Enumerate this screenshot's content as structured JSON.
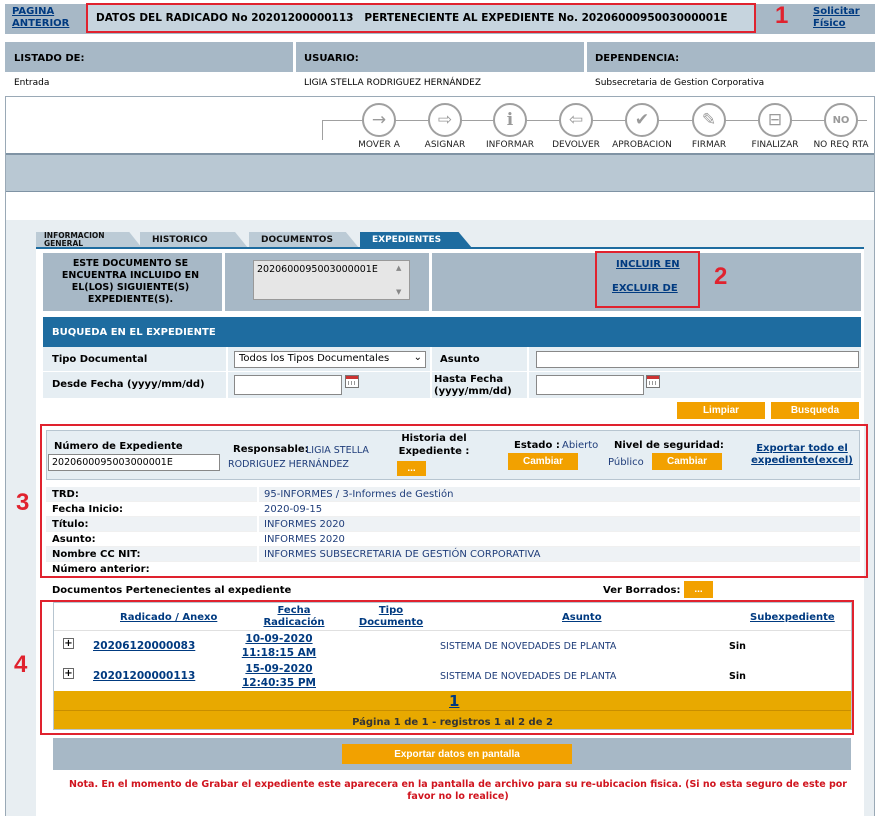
{
  "top": {
    "back_link": "PAGINA ANTERIOR",
    "radicado_title": "DATOS DEL RADICADO No 20201200000113   PERTENECIENTE AL EXPEDIENTE No. 2020600095003000001E",
    "solicitar": "Solicitar Físico"
  },
  "annotations": [
    "1",
    "2",
    "3",
    "4"
  ],
  "info": {
    "listado_label": "LISTADO DE:",
    "usuario_label": "USUARIO:",
    "dependencia_label": "DEPENDENCIA:",
    "listado_value": "Entrada",
    "usuario_value": "LIGIA STELLA RODRIGUEZ HERNÁNDEZ",
    "dependencia_value": "Subsecretaria de Gestion Corporativa"
  },
  "toolbar": [
    {
      "label": "MOVER A",
      "icon": "arrow-right-icon",
      "glyph": "→"
    },
    {
      "label": "ASIGNAR",
      "icon": "assign-icon",
      "glyph": "⇨"
    },
    {
      "label": "INFORMAR",
      "icon": "info-icon",
      "glyph": "i"
    },
    {
      "label": "DEVOLVER",
      "icon": "return-icon",
      "glyph": "⇦"
    },
    {
      "label": "APROBACION",
      "icon": "check-icon",
      "glyph": "✔"
    },
    {
      "label": "FIRMAR",
      "icon": "sign-icon",
      "glyph": "✎"
    },
    {
      "label": "FINALIZAR",
      "icon": "finalize-icon",
      "glyph": "⊟"
    },
    {
      "label": "NO REQ RTA",
      "icon": "no-reply-icon",
      "glyph": "NO"
    }
  ],
  "tabs": [
    "INFORMACION GENERAL",
    "HISTORICO",
    "DOCUMENTOS",
    "EXPEDIENTES"
  ],
  "included": {
    "text": "ESTE DOCUMENTO SE ENCUENTRA INCLUIDO EN EL(LOS) SIGUIENTE(S) EXPEDIENTE(S).",
    "list_value": "2020600095003000001E",
    "incluir": "INCLUIR EN",
    "excluir": "EXCLUIR DE"
  },
  "search": {
    "header": "BUQUEDA EN EL EXPEDIENTE",
    "tipo_label": "Tipo Documental",
    "tipo_value": "Todos los Tipos Documentales",
    "asunto_label": "Asunto",
    "desde_label": "Desde Fecha (yyyy/mm/dd)",
    "hasta_label": "Hasta Fecha (yyyy/mm/dd)",
    "limpiar": "Limpiar",
    "busqueda": "Busqueda"
  },
  "exp": {
    "numero_label": "Número de Expediente",
    "numero_value": "2020600095003000001E",
    "responsable_label": "Responsable:",
    "responsable_value": "LIGIA STELLA RODRIGUEZ HERNÁNDEZ",
    "historia_label": "Historia del Expediente :",
    "historia_btn": "...",
    "estado_label": "Estado :",
    "estado_value": "Abierto",
    "cambiar": "Cambiar",
    "seguridad_label": "Nivel de seguridad:",
    "seguridad_value": "Público",
    "exportar": "Exportar todo el expediente(excel)"
  },
  "details": [
    {
      "label": "TRD:",
      "value": "95-INFORMES / 3-Informes de Gestión"
    },
    {
      "label": "Fecha Inicio:",
      "value": "2020-09-15"
    },
    {
      "label": "Título:",
      "value": "INFORMES 2020"
    },
    {
      "label": "Asunto:",
      "value": "INFORMES 2020"
    },
    {
      "label": "Nombre CC NIT:",
      "value": "INFORMES SUBSECRETARIA DE GESTIÓN CORPORATIVA"
    },
    {
      "label": "Número anterior:",
      "value": ""
    }
  ],
  "docs": {
    "title": "Documentos Pertenecientes al expediente",
    "ver_borrados": "Ver Borrados:",
    "ver_btn": "...",
    "headers": {
      "radicado": "Radicado / Anexo",
      "fecha": "Fecha Radicación",
      "tipo": "Tipo Documento",
      "asunto": "Asunto",
      "subexp": "Subexpediente"
    },
    "rows": [
      {
        "radicado": "20206120000083",
        "fecha": "10-09-2020",
        "hora": "11:18:15 AM",
        "asunto": "SISTEMA DE NOVEDADES DE PLANTA",
        "sub": "Sin"
      },
      {
        "radicado": "20201200000113",
        "fecha": "15-09-2020",
        "hora": "12:40:35 PM",
        "asunto": "SISTEMA DE NOVEDADES DE PLANTA",
        "sub": "Sin"
      }
    ],
    "page_num": "1",
    "page_info": "Página 1 de 1 - registros 1 al 2 de 2",
    "export_btn": "Exportar datos en pantalla"
  },
  "note": "Nota. En el momento de Grabar el expediente este aparecera en la pantalla de archivo para su re-ubicacion fisica. (Si no esta seguro de este por favor no lo realice)"
}
